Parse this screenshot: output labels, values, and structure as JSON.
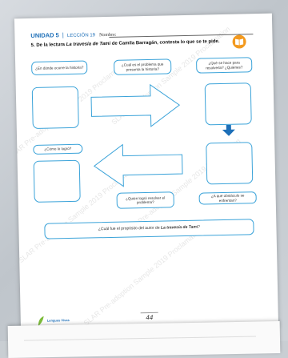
{
  "header": {
    "unit": "UNIDAD 5",
    "lesson": "LECCIÓN 19",
    "name_label": "Nombre:"
  },
  "question": {
    "number": "5.",
    "text_before": "De la lectura",
    "reading_title": "La travesía de Tami",
    "text_after": "de Camila Barragán, contesta lo que se te pide."
  },
  "boxes": {
    "where": "¿En dónde ocurre la historia?",
    "problem": "¿Cuál es el problema que presenta la historia?",
    "solve": "¿Qué se hace para resolverla? ¿Quiénes?",
    "how": "¿Cómo lo logró?",
    "who": "¿Quién logró resolver el problema?",
    "obstacle": "¿A qué obstáculo se enfrentan?",
    "purpose_before": "¿Cuál fue el propósito del autor de",
    "purpose_title": "La travesía de Tami",
    "purpose_after": "?"
  },
  "watermark": "SLAR Pre-adoption Sample 2019 Proclamation",
  "footer": {
    "logo": "Lenguas Vivas",
    "page_number": "44"
  },
  "colors": {
    "accent": "#1d6fb8",
    "box_border": "#3ba3d9",
    "badge": "#f39a1f"
  },
  "icons": {
    "badge": "book-icon",
    "flow_down": "arrow-down-icon"
  }
}
